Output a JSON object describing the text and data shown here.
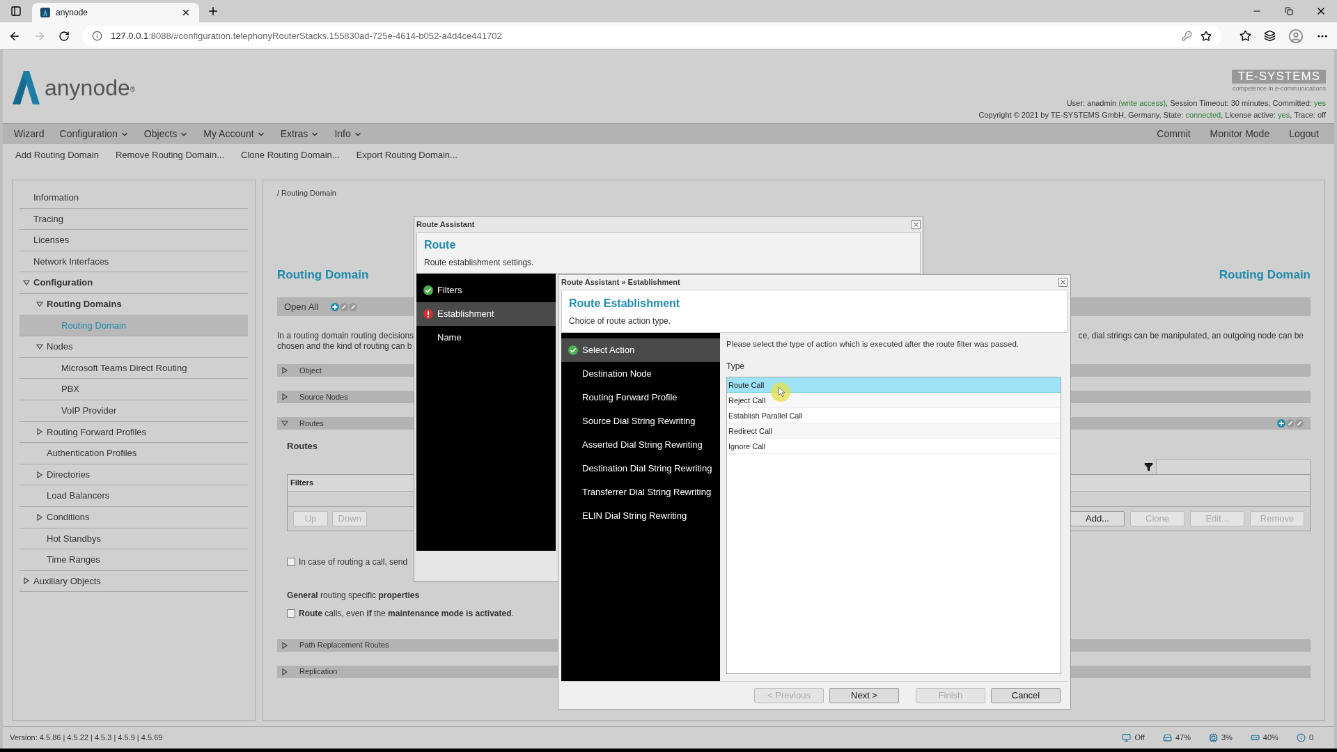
{
  "browser": {
    "tab_title": "anynode",
    "url_host": "127.0.0.1",
    "url_rest": ":8088/#configuration.telephonyRouterStacks.155830ad-725e-4614-b052-a4d4ce441702"
  },
  "header": {
    "logo_text": "anynode",
    "logo_mark": "®",
    "company_logo": "TE-SYSTEMS",
    "company_tagline": "competence in e-communications",
    "status_lines": [
      [
        {
          "text": "User: anadmin ",
          "highlight": false
        },
        {
          "text": "(write access)",
          "highlight": true
        },
        {
          "text": ", Session Timeout: 30 minutes, Committed: ",
          "highlight": false
        },
        {
          "text": "yes",
          "highlight": true
        }
      ],
      [
        {
          "text": "Copyright © 2021 by TE-SYSTEMS GmbH, Germany, State: ",
          "highlight": false
        },
        {
          "text": "connected",
          "highlight": true
        },
        {
          "text": ", License active: ",
          "highlight": false
        },
        {
          "text": "yes",
          "highlight": true
        },
        {
          "text": ", Trace: off",
          "highlight": false
        }
      ]
    ]
  },
  "menu": [
    {
      "label": "Wizard",
      "dropdown": false
    },
    {
      "label": "Configuration",
      "dropdown": true
    },
    {
      "label": "Objects",
      "dropdown": true
    },
    {
      "label": "My Account",
      "dropdown": true
    },
    {
      "label": "Extras",
      "dropdown": true
    },
    {
      "label": "Info",
      "dropdown": true
    }
  ],
  "menu_right": [
    "Commit",
    "Monitor Mode",
    "Logout"
  ],
  "toolbar": [
    "Add Routing Domain",
    "Remove Routing Domain...",
    "Clone Routing Domain...",
    "Export Routing Domain..."
  ],
  "sidebar": {
    "items": [
      {
        "label": "Information",
        "selected": false
      },
      {
        "label": "Tracing",
        "selected": false
      },
      {
        "label": "Licenses",
        "selected": false
      },
      {
        "label": "Network Interfaces",
        "selected": false
      },
      {
        "label": "Configuration",
        "selected": false,
        "expanded": true,
        "children": [
          {
            "label": "Routing Domains",
            "selected": false,
            "expanded": true,
            "children": [
              {
                "label": "Routing Domain",
                "selected": true
              }
            ]
          },
          {
            "label": "Nodes",
            "selected": false,
            "expanded": true,
            "children": [
              {
                "label": "Microsoft Teams Direct Routing",
                "selected": false
              },
              {
                "label": "PBX",
                "selected": false
              },
              {
                "label": "VoIP Provider",
                "selected": false
              }
            ]
          },
          {
            "label": "Routing Forward Profiles",
            "selected": false,
            "expanded": false
          },
          {
            "label": "Authentication Profiles",
            "selected": false
          },
          {
            "label": "Directories",
            "selected": false,
            "expanded": false
          },
          {
            "label": "Load Balancers",
            "selected": false
          },
          {
            "label": "Conditions",
            "selected": false,
            "expanded": false
          },
          {
            "label": "Hot Standbys",
            "selected": false
          },
          {
            "label": "Time Ranges",
            "selected": false
          }
        ]
      },
      {
        "label": "Auxiliary Objects",
        "selected": false,
        "expanded": false
      }
    ]
  },
  "content": {
    "breadcrumb": "/ Routing Domain",
    "headings": [
      "Routing Domain",
      "Routing Domain"
    ],
    "open_all": "Open All",
    "description_left": [
      "In a routing domain routing decisions",
      "chosen and the kind of routing can b"
    ],
    "description_right": "ce, dial strings can be manipulated, an outgoing node can be",
    "sections_top": [
      {
        "title": "Object",
        "expanded": false
      },
      {
        "title": "Source Nodes",
        "expanded": false
      },
      {
        "title": "Routes",
        "expanded": true
      }
    ],
    "routes": {
      "label": "Routes",
      "table_header": "Filters",
      "buttons_left": [
        {
          "label": "Up",
          "disabled": true
        },
        {
          "label": "Down",
          "disabled": true
        }
      ],
      "buttons_right": [
        {
          "label": "Add...",
          "disabled": false
        },
        {
          "label": "Clone",
          "disabled": true
        },
        {
          "label": "Edit...",
          "disabled": true
        },
        {
          "label": "Remove",
          "disabled": true
        }
      ]
    },
    "send_option": {
      "label": "In case of routing a call, send",
      "checked": false
    },
    "general_heading": "**General** routing specific **properties**",
    "maintenance_option": {
      "label": "**Route** calls, even **if** the **maintenance mode is activated**.",
      "checked": false
    },
    "sections_bottom": [
      {
        "title": "Path Replacement Routes",
        "expanded": false
      },
      {
        "title": "Replication",
        "expanded": false
      }
    ]
  },
  "outer_dialog": {
    "title": "Route Assistant",
    "heading": "Route",
    "subtitle": "Route establishment settings.",
    "steps": [
      {
        "label": "Filters",
        "kind": "done",
        "selected": false
      },
      {
        "label": "Establishment",
        "kind": "error",
        "selected": true
      },
      {
        "label": "Name",
        "kind": "plain",
        "selected": false
      }
    ]
  },
  "inner_dialog": {
    "title": "Route Assistant » Establishment",
    "heading": "Route Establishment",
    "subtitle": "Choice of route action type.",
    "steps": [
      {
        "label": "Select Action",
        "kind": "done",
        "selected": true
      },
      {
        "label": "Destination Node",
        "kind": "plain",
        "selected": false
      },
      {
        "label": "Routing Forward Profile",
        "kind": "plain",
        "selected": false
      },
      {
        "label": "Source Dial String Rewriting",
        "kind": "plain",
        "selected": false
      },
      {
        "label": "Asserted Dial String Rewriting",
        "kind": "plain",
        "selected": false
      },
      {
        "label": "Destination Dial String Rewriting",
        "kind": "plain",
        "selected": false
      },
      {
        "label": "Transferrer Dial String Rewriting",
        "kind": "plain",
        "selected": false
      },
      {
        "label": "ELIN Dial String Rewriting",
        "kind": "plain",
        "selected": false
      }
    ],
    "instruction": "Please select the type of action which is executed after the route filter was passed.",
    "type_label": "Type",
    "types": [
      {
        "label": "Route Call",
        "selected": true
      },
      {
        "label": "Reject Call",
        "selected": false
      },
      {
        "label": "Establish Parallel Call",
        "selected": false
      },
      {
        "label": "Redirect Call",
        "selected": false
      },
      {
        "label": "Ignore Call",
        "selected": false
      }
    ],
    "buttons": [
      {
        "label": "< Previous",
        "disabled": true
      },
      {
        "label": "Next >",
        "disabled": false
      },
      {
        "label": "Finish",
        "disabled": true
      },
      {
        "label": "Cancel",
        "disabled": false
      }
    ]
  },
  "status_bar": {
    "version": "Version: 4.5.86 | 4.5.22 | 4.5.3 | 4.5.9 | 4.5.69",
    "indicators": [
      {
        "kind": "monitor",
        "text": "Off"
      },
      {
        "kind": "disk",
        "text": "47%"
      },
      {
        "kind": "cpu",
        "text": "3%"
      },
      {
        "kind": "memory",
        "text": "40%"
      },
      {
        "kind": "info",
        "text": "0"
      }
    ]
  }
}
